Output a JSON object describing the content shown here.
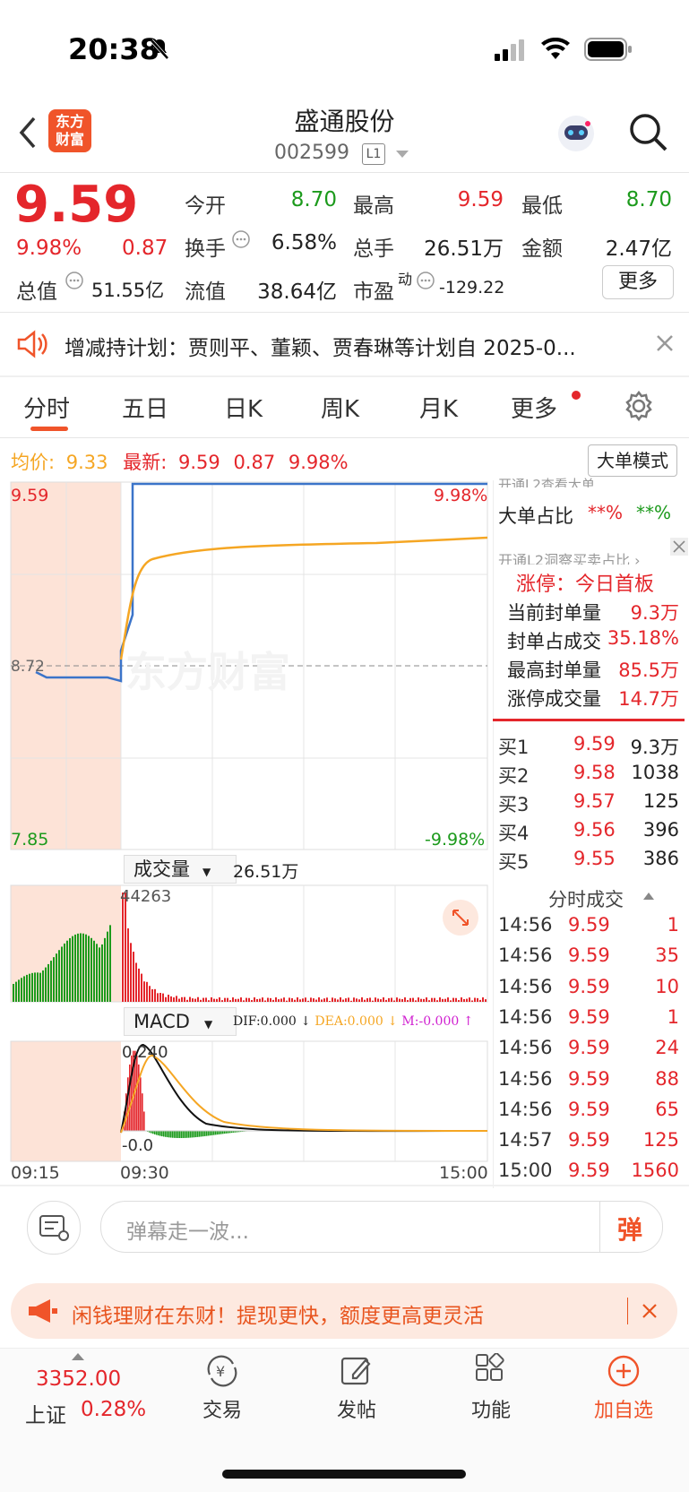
{
  "status": {
    "time": "20:38"
  },
  "header": {
    "logo_text": "东方\n财富",
    "title": "盛通股份",
    "code": "002599",
    "level": "L1"
  },
  "quote": {
    "price": "9.59",
    "pct": "9.98%",
    "chg": "0.87",
    "open_label": "今开",
    "open": "8.70",
    "high_label": "最高",
    "high": "9.59",
    "low_label": "最低",
    "low": "8.70",
    "turnover_label": "换手",
    "turnover": "6.58%",
    "volume_label": "总手",
    "volume": "26.51万",
    "amount_label": "金额",
    "amount": "2.47亿",
    "mktcap_label": "总值",
    "mktcap": "51.55亿",
    "float_label": "流值",
    "float": "38.64亿",
    "pe_label": "市盈",
    "pe_sup": "动",
    "pe": "-129.22",
    "more": "更多"
  },
  "notice": {
    "text": "增减持计划：贾则平、董颖、贾春琳等计划自 2025-0..."
  },
  "tabs": [
    "分时",
    "五日",
    "日K",
    "周K",
    "月K",
    "更多"
  ],
  "info_bar": {
    "avg_label": "均价:",
    "avg": "9.33",
    "last_label": "最新:",
    "last": "9.59",
    "chg": "0.87",
    "pct": "9.98%",
    "mode": "大单模式"
  },
  "chart": {
    "y_top": "9.59",
    "y_mid": "8.72",
    "y_bot": "7.85",
    "pct_top": "9.98%",
    "pct_bot": "-9.98%",
    "vol_label": "成交量",
    "vol_total": "26.51万",
    "vol_max": "44263",
    "macd_label": "MACD",
    "dif": "DIF:0.000",
    "dea": "DEA:0.000",
    "m": "M:-0.000",
    "macd_top": "0.240",
    "macd_bot": "-0.0",
    "t_start": "09:15",
    "t_open": "09:30",
    "t_end": "15:00",
    "watermark": "东方财富"
  },
  "side": {
    "l2_top": "开通L2查看大单",
    "big_label": "大单占比",
    "big_v1": "**%",
    "big_v2": "**%",
    "l2_mid": "开通L2洞察买卖占比 ›",
    "limit_title": "涨停：今日首板",
    "rows": [
      {
        "label": "当前封单量",
        "value": "9.3万"
      },
      {
        "label": "封单占成交",
        "value": "35.18%"
      },
      {
        "label": "最高封单量",
        "value": "85.5万"
      },
      {
        "label": "涨停成交量",
        "value": "14.7万"
      }
    ],
    "bids": [
      {
        "label": "买1",
        "price": "9.59",
        "vol": "9.3万"
      },
      {
        "label": "买2",
        "price": "9.58",
        "vol": "1038"
      },
      {
        "label": "买3",
        "price": "9.57",
        "vol": "125"
      },
      {
        "label": "买4",
        "price": "9.56",
        "vol": "396"
      },
      {
        "label": "买5",
        "price": "9.55",
        "vol": "386"
      }
    ],
    "ticks_title": "分时成交",
    "ticks": [
      {
        "t": "14:56",
        "p": "9.59",
        "v": "1"
      },
      {
        "t": "14:56",
        "p": "9.59",
        "v": "35"
      },
      {
        "t": "14:56",
        "p": "9.59",
        "v": "10"
      },
      {
        "t": "14:56",
        "p": "9.59",
        "v": "1"
      },
      {
        "t": "14:56",
        "p": "9.59",
        "v": "24"
      },
      {
        "t": "14:56",
        "p": "9.59",
        "v": "88"
      },
      {
        "t": "14:56",
        "p": "9.59",
        "v": "65"
      },
      {
        "t": "14:57",
        "p": "9.59",
        "v": "125"
      },
      {
        "t": "15:00",
        "p": "9.59",
        "v": "1560"
      }
    ]
  },
  "comment": {
    "placeholder": "弹幕走一波...",
    "send": "弹"
  },
  "ad": {
    "text": "闲钱理财在东财！提现更快，额度更高更灵活"
  },
  "tabbar": {
    "index_value": "3352.00",
    "index_name": "上证",
    "index_pct": "0.28%",
    "trade": "交易",
    "post": "发帖",
    "func": "功能",
    "add": "加自选"
  },
  "colors": {
    "red": "#e4262b",
    "green": "#1c9a1c",
    "orange": "#f0542a",
    "avg_line": "#f5a623",
    "price_line": "#3b74c9"
  }
}
